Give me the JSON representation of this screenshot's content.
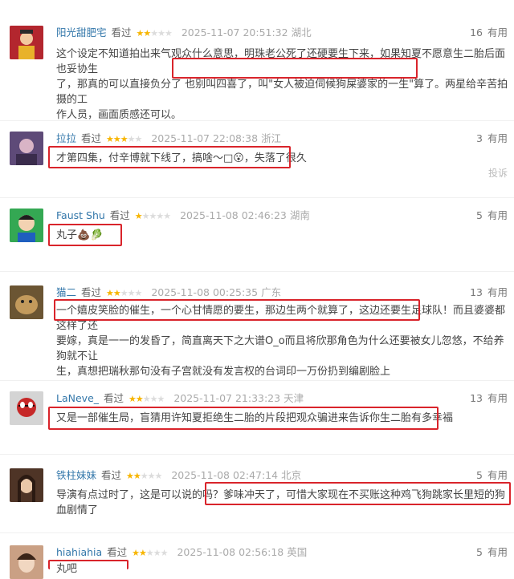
{
  "comments": [
    {
      "user": "阳光甜肥宅",
      "watched": "看过",
      "rating": 2,
      "time": "2025-11-07 20:51:32",
      "location": "湖北",
      "votes": "16",
      "useful_label": "有用",
      "lines": [
        "这个设定不知道拍出来气观众什么意思，明珠老公死了还硬要生下来，如果知夏不愿意生二胎后面也妥协生",
        "了，那真的可以直接负分了 也别叫四喜了，叫\"女人被迫伺候狗屎婆家的一生\"算了。两星给辛苦拍摄的工",
        "作人员，画面质感还可以。"
      ]
    },
    {
      "user": "拉拉",
      "watched": "看过",
      "rating": 3,
      "time": "2025-11-07 22:08:38",
      "location": "浙江",
      "votes": "3",
      "useful_label": "有用",
      "lines": [
        "才第四集，付辛博就下线了，搞啥～□😮，失落了很久"
      ],
      "report": "投诉"
    },
    {
      "user": "Faust Shu",
      "watched": "看过",
      "rating": 1,
      "time": "2025-11-08 02:46:23",
      "location": "湖南",
      "votes": "5",
      "useful_label": "有用",
      "lines": [
        "丸子💩🥬"
      ]
    },
    {
      "user": "猫二",
      "watched": "看过",
      "rating": 2,
      "time": "2025-11-08 00:25:35",
      "location": "广东",
      "votes": "13",
      "useful_label": "有用",
      "lines": [
        "一个嬉皮笑脸的催生，一个心甘情愿的要生，那边生两个就算了，这边还要生足球队！而且婆婆都这样了还",
        "要嫁，真是一一的发昏了，简直离天下之大谱O_o而且将欣那角色为什么还要被女儿忽悠，不给养狗就不让",
        "生，真想把瑞秋那句没有子宫就没有发言权的台词印一万份扔到编剧脸上"
      ]
    },
    {
      "user": "LaNeve_",
      "watched": "看过",
      "rating": 2,
      "time": "2025-11-07 21:33:23",
      "location": "天津",
      "votes": "13",
      "useful_label": "有用",
      "lines": [
        "又是一部催生局，盲猜用许知夏拒绝生二胎的片段把观众骗进来告诉你生二胎有多幸福"
      ]
    },
    {
      "user": "铁柱妹妹",
      "watched": "看过",
      "rating": 2,
      "time": "2025-11-08 02:47:14",
      "location": "北京",
      "votes": "5",
      "useful_label": "有用",
      "lines": [
        "导演有点过时了，这是可以说的吗？爹味冲天了，可惜大家现在不买账这种鸡飞狗跳家长里短的狗血剧情了"
      ]
    },
    {
      "user": "hiahiahia",
      "watched": "看过",
      "rating": 2,
      "time": "2025-11-08 02:56:18",
      "location": "英国",
      "votes": "5",
      "useful_label": "有用",
      "lines": [
        "丸吧"
      ]
    }
  ],
  "colors": {
    "highlight": "#d9242b",
    "username": "#3377aa",
    "star": "#f7b500"
  }
}
